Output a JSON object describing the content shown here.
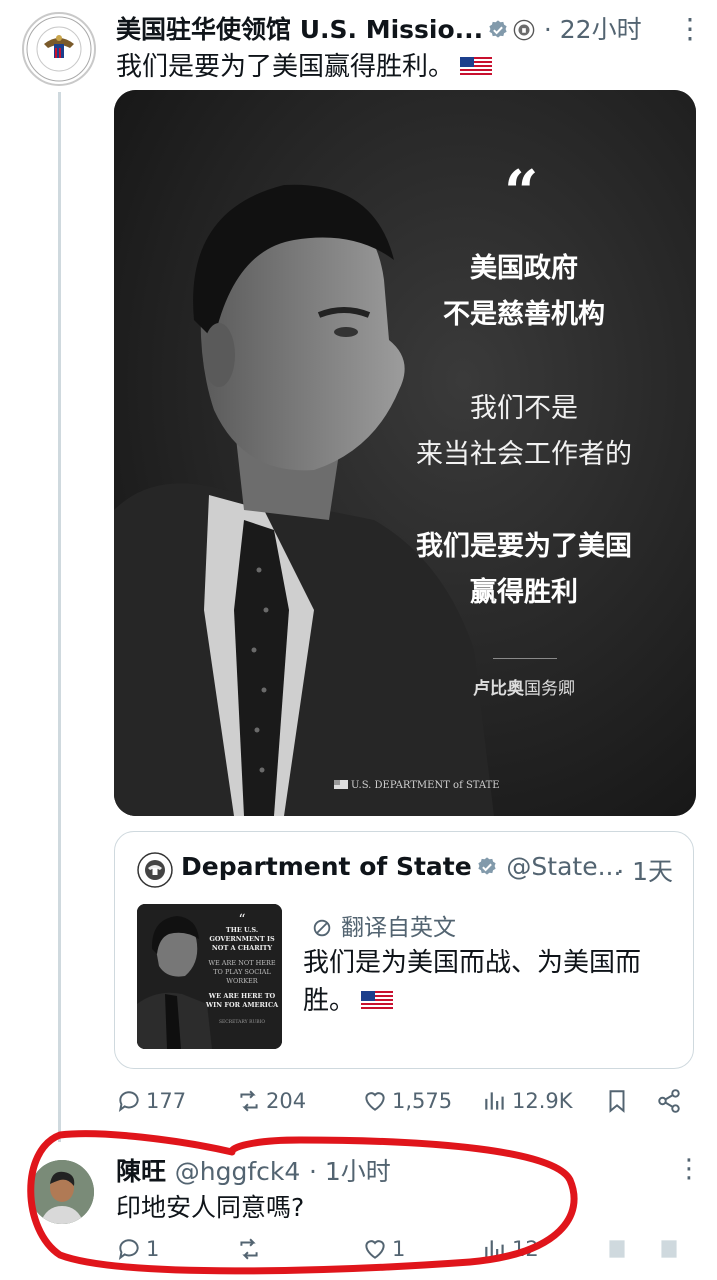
{
  "tweet": {
    "author_name": "美国驻华使领馆 U.S. Missio...",
    "time": "· 22小时",
    "text": "我们是要为了美国赢得胜利。",
    "more_icon": "more-vertical-icon",
    "image": {
      "quote_lines_1": [
        "美国政府",
        "不是慈善机构"
      ],
      "quote_lines_2": [
        "我们不是",
        "来当社会工作者的"
      ],
      "quote_lines_3": [
        "我们是要为了美国",
        "赢得胜利"
      ],
      "signature_bold": "卢比奥",
      "signature_rest": "国务卿",
      "footer": "U.S. DEPARTMENT of STATE"
    }
  },
  "quoted": {
    "author_name": "Department of State",
    "handle": "@State...",
    "time": "· 1天",
    "translate_label": "翻译自英文",
    "text": "我们是为美国而战、为美国而胜。",
    "thumb_lines": [
      "THE U.S. GOVERNMENT IS NOT A CHARITY",
      "WE ARE NOT HERE TO PLAY SOCIAL WORKER",
      "WE ARE HERE TO WIN FOR AMERICA",
      "SECRETARY RUBIO"
    ]
  },
  "actions": {
    "replies": "177",
    "reposts": "204",
    "likes": "1,575",
    "views": "12.9K"
  },
  "reply": {
    "author_name": "陳旺",
    "handle": "@hggfck4",
    "time": "· 1小时",
    "text": "印地安人同意嗎?",
    "replies": "1",
    "likes": "1",
    "views": "12"
  },
  "colors": {
    "text": "#0f1419",
    "secondary": "#536471",
    "verified": "#829aab",
    "annotation": "#e0151b"
  }
}
